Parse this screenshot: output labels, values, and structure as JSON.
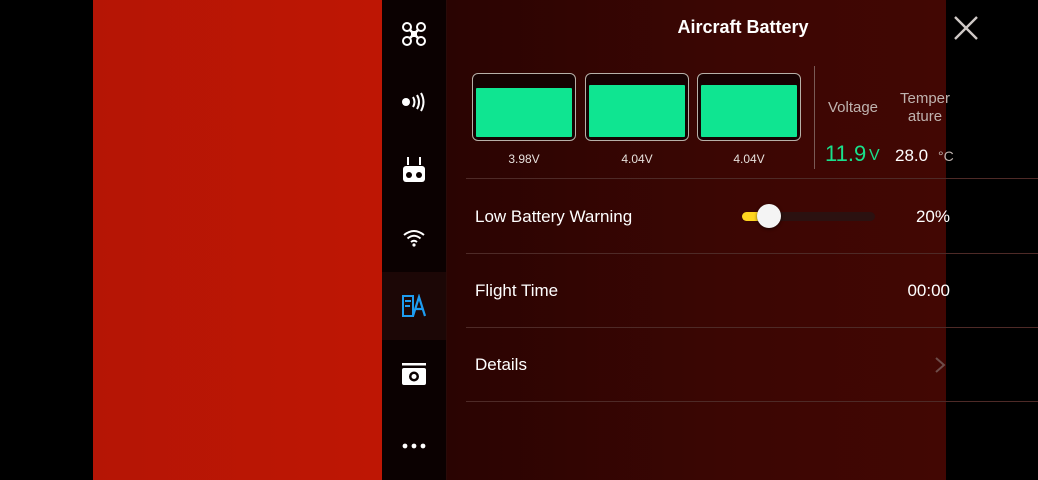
{
  "panel": {
    "title": "Aircraft Battery",
    "close_icon": "close-icon"
  },
  "sidebar": {
    "items": [
      {
        "icon": "aircraft-icon",
        "active": false
      },
      {
        "icon": "remote-signal-icon",
        "active": false
      },
      {
        "icon": "remote-controller-icon",
        "active": false
      },
      {
        "icon": "wifi-icon",
        "active": false
      },
      {
        "icon": "battery-settings-icon",
        "active": true
      },
      {
        "icon": "camera-icon",
        "active": false
      },
      {
        "icon": "more-icon",
        "active": false
      }
    ]
  },
  "battery": {
    "cells": [
      {
        "voltage": "3.98V",
        "level": 0.81
      },
      {
        "voltage": "4.04V",
        "level": 0.86
      },
      {
        "voltage": "4.04V",
        "level": 0.86
      }
    ],
    "voltage_label": "Voltage",
    "voltage_value": "11.9",
    "voltage_unit": "V",
    "temperature_label_line1": "Temper",
    "temperature_label_line2": "ature",
    "temperature_value": "28.0",
    "temperature_unit": "°C"
  },
  "low_battery_warning": {
    "label": "Low Battery Warning",
    "value": "20%",
    "level": 0.2
  },
  "flight_time": {
    "label": "Flight Time",
    "value": "00:00"
  },
  "details": {
    "label": "Details",
    "chevron_icon": "chevron-right-icon"
  },
  "colors": {
    "accent_green": "#0fe591",
    "slider_yellow": "#ffd51f",
    "active_icon_blue": "#1e9cf0",
    "camera_red": "#b51505"
  }
}
